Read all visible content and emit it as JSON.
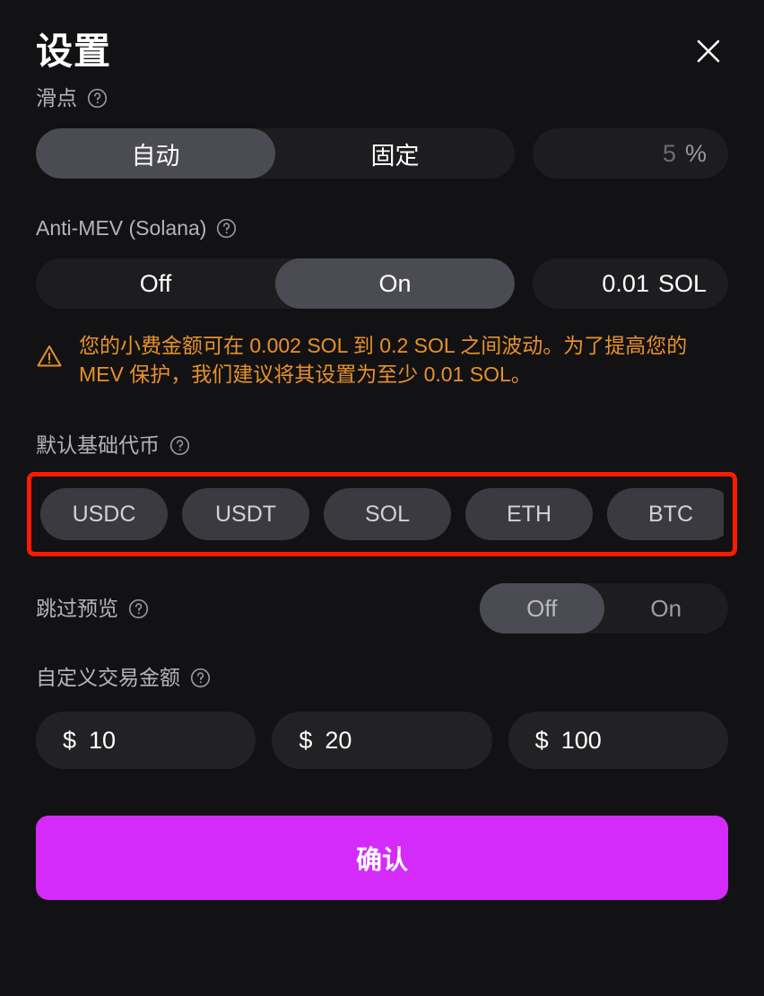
{
  "header": {
    "title": "设置",
    "close_icon": "close-icon"
  },
  "slippage": {
    "label": "滑点",
    "help_icon": "help-circle-icon",
    "options": [
      {
        "label": "自动",
        "selected": true
      },
      {
        "label": "固定",
        "selected": false
      }
    ],
    "value": "5",
    "unit": "%"
  },
  "anti_mev": {
    "label": "Anti-MEV (Solana)",
    "help_icon": "help-circle-icon",
    "options": [
      {
        "label": "Off",
        "selected": false
      },
      {
        "label": "On",
        "selected": true
      }
    ],
    "value": "0.01",
    "unit": "SOL",
    "warning_icon": "warning-triangle-icon",
    "warning_text": "您的小费金额可在 0.002 SOL 到 0.2 SOL 之间波动。为了提高您的 MEV 保护，我们建议将其设置为至少 0.01 SOL。",
    "warning_color": "#e8912a"
  },
  "default_base_token": {
    "label": "默认基础代币",
    "help_icon": "help-circle-icon",
    "highlight_color": "#ff1a00",
    "tokens": [
      {
        "label": "USDC"
      },
      {
        "label": "USDT"
      },
      {
        "label": "SOL"
      },
      {
        "label": "ETH"
      },
      {
        "label": "BTC"
      }
    ]
  },
  "skip_preview": {
    "label": "跳过预览",
    "help_icon": "help-circle-icon",
    "options": [
      {
        "label": "Off",
        "selected": true
      },
      {
        "label": "On",
        "selected": false
      }
    ]
  },
  "custom_amounts": {
    "label": "自定义交易金额",
    "help_icon": "help-circle-icon",
    "currency_sign": "$",
    "values": [
      "10",
      "20",
      "100"
    ]
  },
  "confirm": {
    "label": "确认",
    "color": "#d42bfb"
  }
}
